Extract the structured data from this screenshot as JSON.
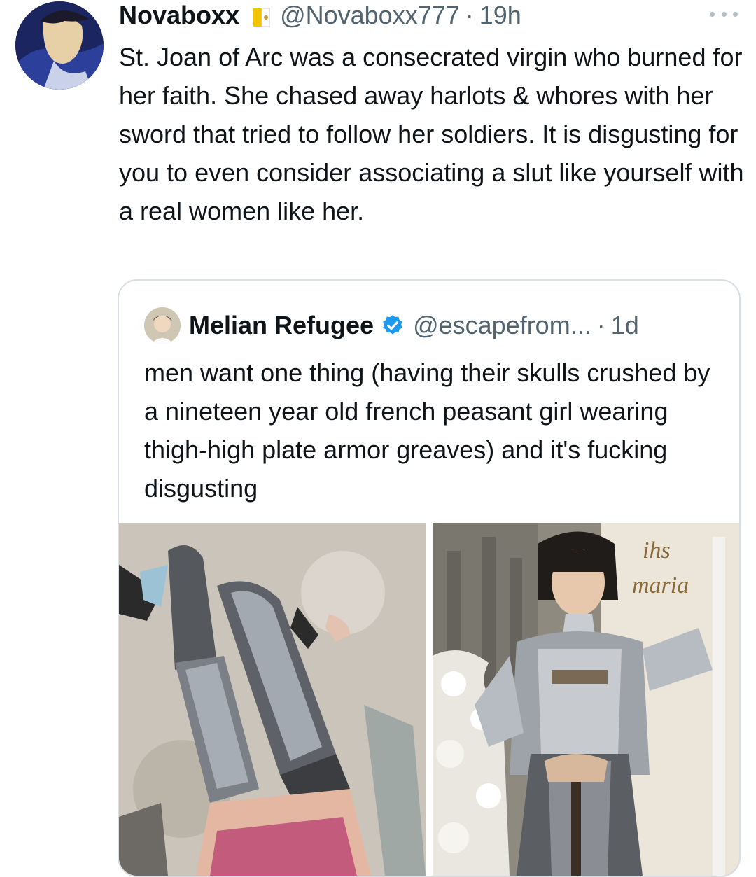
{
  "tweet": {
    "author_name": "Novaboxx",
    "flag_icon": "vatican-flag-icon",
    "handle": "@Novaboxx777",
    "separator": "·",
    "time": "19h",
    "more_icon": "more-options-icon",
    "text": "St. Joan of Arc was a consecrated virgin who burned for her faith. She chased away harlots & whores with her sword that tried to follow her soldiers. It is disgusting for you to even consider associating a slut like yourself with a real women like her."
  },
  "quoted": {
    "author_name": "Melian Refugee",
    "verified_icon": "verified-badge-icon",
    "handle": "@escapefrom...",
    "separator": "·",
    "time": "1d",
    "text": "men want one thing (having their skulls crushed by a nineteen year old french peasant girl wearing thigh-high plate armor greaves) and it's fucking disgusting",
    "images": [
      {
        "name": "armor-legs-photo"
      },
      {
        "name": "joan-of-arc-painting"
      }
    ]
  },
  "colors": {
    "text": "#0f1419",
    "secondary": "#536471",
    "border": "#d8dee3",
    "verified": "#1d9bf0"
  }
}
